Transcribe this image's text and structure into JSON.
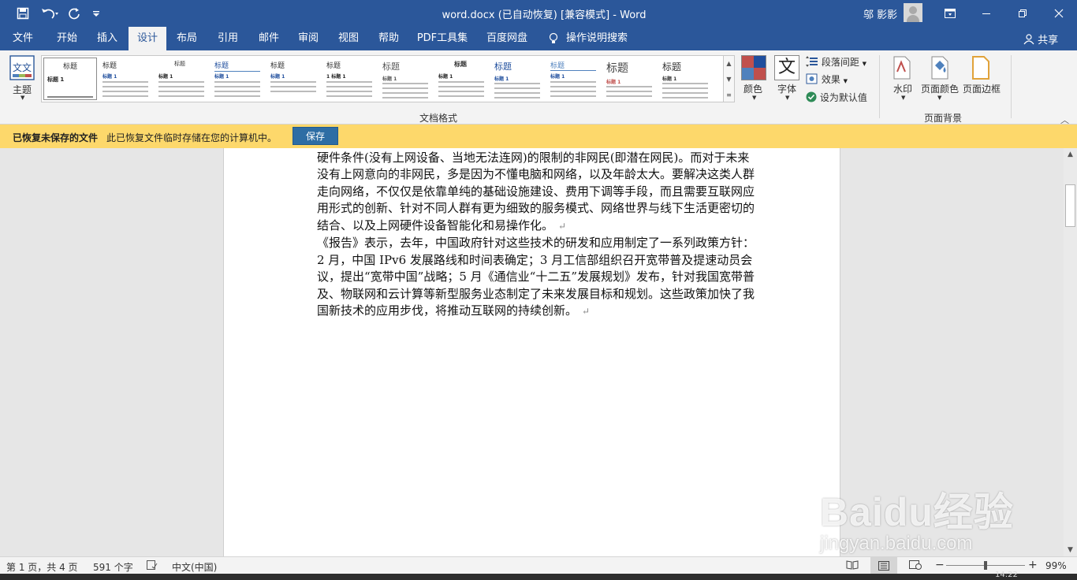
{
  "titlebar": {
    "save_icon": "save-icon",
    "undo_icon": "undo-icon",
    "redo_icon": "redo-icon",
    "customize_icon": "customize-quick-access-icon",
    "title": "word.docx (已自动恢复) [兼容模式] - Word",
    "user": "邬 影影",
    "buttons": [
      "ribbon-display-options",
      "minimize",
      "restore",
      "close"
    ]
  },
  "tabs": [
    {
      "label": "文件"
    },
    {
      "label": "开始"
    },
    {
      "label": "插入"
    },
    {
      "label": "设计"
    },
    {
      "label": "布局"
    },
    {
      "label": "引用"
    },
    {
      "label": "邮件"
    },
    {
      "label": "审阅"
    },
    {
      "label": "视图"
    },
    {
      "label": "帮助"
    },
    {
      "label": "PDF工具集"
    },
    {
      "label": "百度网盘"
    },
    {
      "label": "操作说明搜索"
    }
  ],
  "active_tab": "设计",
  "share": "共享",
  "ribbon": {
    "theme_label": "主题",
    "gallery_items": [
      {
        "h1": "标题",
        "h2": "标题 1"
      },
      {
        "h1": "标题",
        "h2": "标题 1"
      },
      {
        "h1": "标题",
        "h2": "标题 1"
      },
      {
        "h1": "标题",
        "h2": "标题 1"
      },
      {
        "h1": "标题",
        "h2": "标题 1"
      },
      {
        "h1": "标题",
        "h2": "1 标题 1"
      },
      {
        "h1": "标题",
        "h2": "标题 1"
      },
      {
        "h1": "标题",
        "h2": "标题 1"
      },
      {
        "h1": "标题",
        "h2": "标题 1"
      },
      {
        "h1": "标题",
        "h2": "标题 1"
      },
      {
        "h1": "标题",
        "h2": "标题 1"
      },
      {
        "h1": "标题",
        "h2": "标题 1"
      }
    ],
    "colors_label": "颜色",
    "fonts_label": "字体",
    "fonts_glyph": "文",
    "paragraph_spacing_label": "段落间距",
    "effects_label": "效果",
    "set_default_label": "设为默认值",
    "document_format_group": "文档格式",
    "watermark_label": "水印",
    "page_color_label": "页面颜色",
    "page_borders_label": "页面边框",
    "page_background_group": "页面背景"
  },
  "infobar": {
    "title": "已恢复未保存的文件",
    "message": "此已恢复文件临时存储在您的计算机中。",
    "save_button": "保存"
  },
  "document": {
    "paragraphs": [
      "《报告》组织了·汉族大结的资来信求纳分析主要来自农村互相的原接(接时间主网)和硬件条件(没有上网设备、当地无法连网)的限制的非网民(即潜在网民)。而对于未来没有上网意向的非网民，多是因为不懂电脑和网络，以及年龄太大。要解决这类人群走向网络，不仅仅是依靠单纯的基础设施建设、费用下调等手段，而且需要互联网应用形式的创新、针对不同人群有更为细致的服务模式、网络世界与线下生活更密切的结合、以及上网硬件设备智能化和易操作化。",
      "《报告》表示，去年，中国政府针对这些技术的研发和应用制定了一系列政策方针：2 月，中国 IPv6 发展路线和时间表确定；3 月工信部组织召开宽带普及提速动员会议，提出“宽带中国”战略；5 月《通信业“十二五”发展规划》发布，针对我国宽带普及、物联网和云计算等新型服务业态制定了未来发展目标和规划。这些政策加快了我国新技术的应用步伐，将推动互联网的持续创新。"
    ],
    "paragraph_mark": "↵"
  },
  "statusbar": {
    "page": "第 1 页，共 4 页",
    "words": "591 个字",
    "language": "中文(中国)",
    "zoom": "99%",
    "zoom_percent": 99
  },
  "watermark": {
    "brand": "Baidu经验",
    "url": "jingyan.baidu.com"
  },
  "clock": "14:22"
}
